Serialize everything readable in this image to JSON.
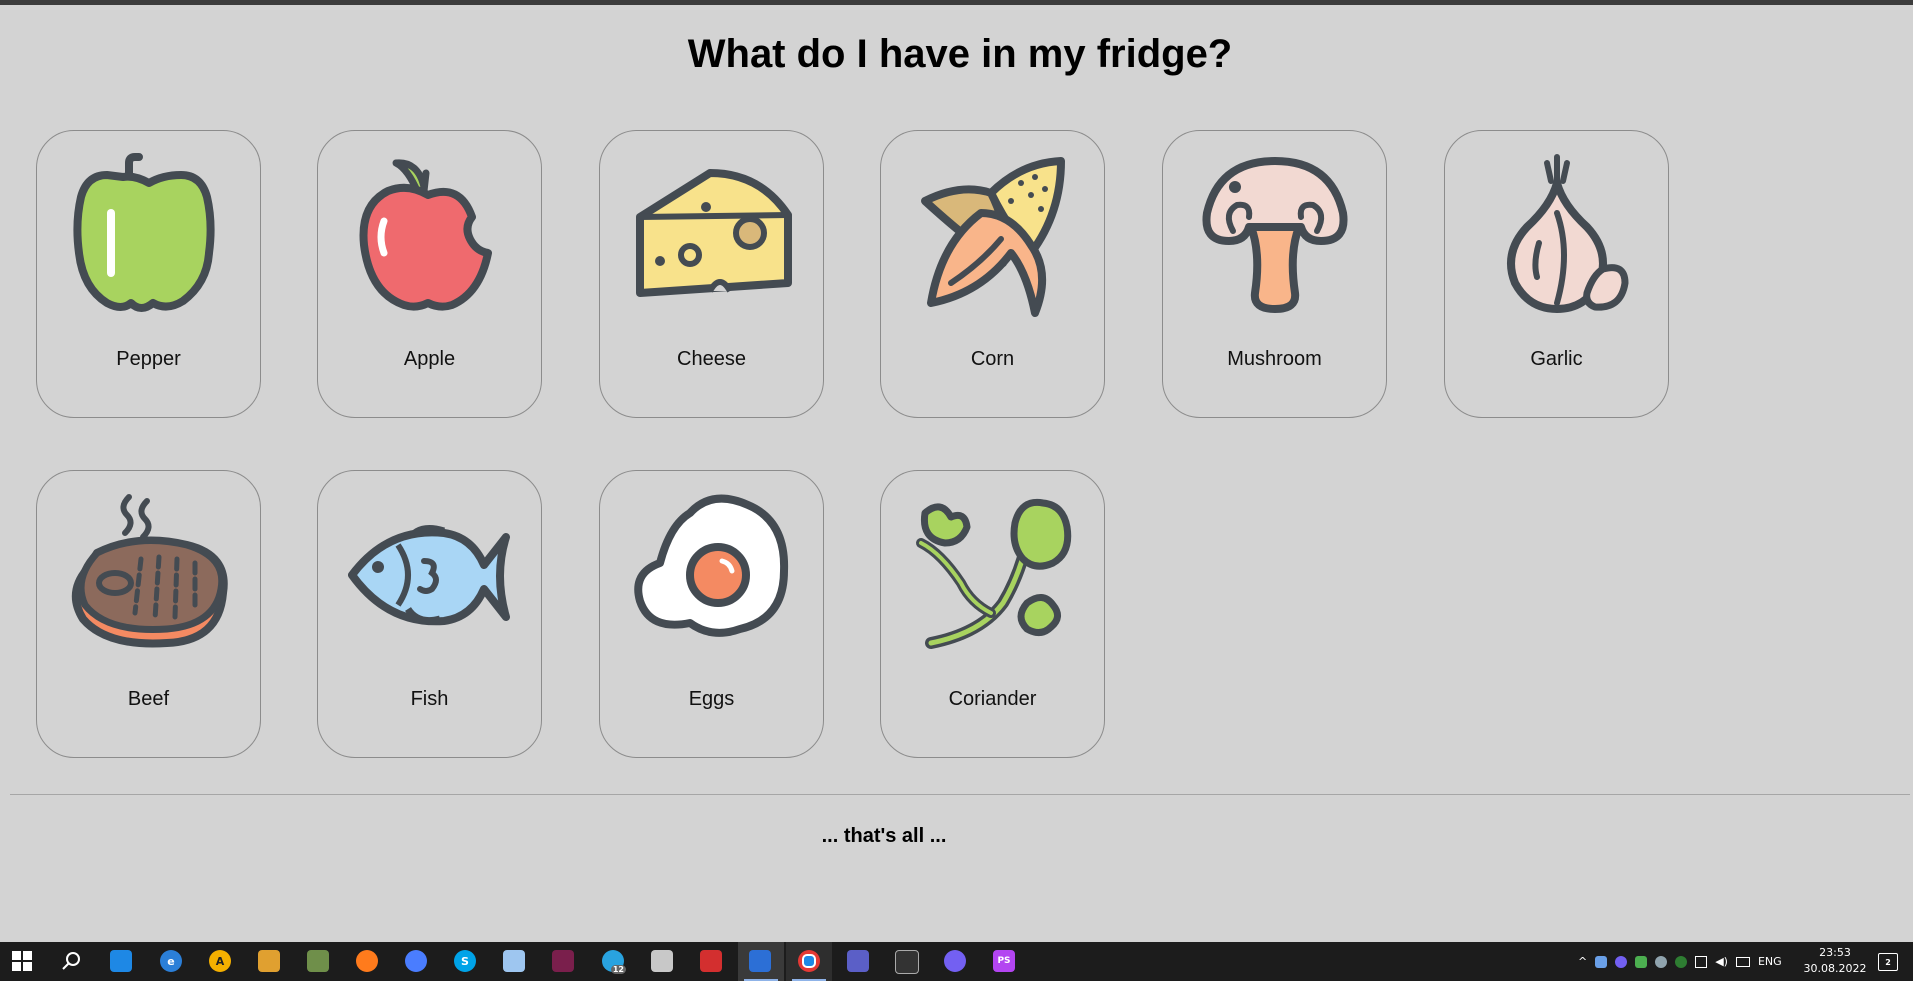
{
  "title": "What do I have in my fridge?",
  "items": [
    {
      "label": "Pepper"
    },
    {
      "label": "Apple"
    },
    {
      "label": "Cheese"
    },
    {
      "label": "Corn"
    },
    {
      "label": "Mushroom"
    },
    {
      "label": "Garlic"
    },
    {
      "label": "Beef"
    },
    {
      "label": "Fish"
    },
    {
      "label": "Eggs"
    },
    {
      "label": "Coriander"
    }
  ],
  "footer": "... that's all ...",
  "taskbar": {
    "apps": [
      "start-icon",
      "search-icon",
      "task-view-icon",
      "edge-icon",
      "norton-icon",
      "git-icon",
      "gimp-icon",
      "firefox-icon",
      "firefox-dev-icon",
      "skype-icon",
      "notepad-icon",
      "winrar-icon",
      "telegram-icon",
      "explorer-icon",
      "acrobat-icon",
      "media-player-icon",
      "chrome-icon",
      "teams-icon",
      "terminal-icon",
      "viber-icon",
      "phpstorm-icon"
    ],
    "telegram_badge": "12",
    "language": "ENG",
    "time": "23:53",
    "date": "30.08.2022",
    "notification_count": "2"
  }
}
